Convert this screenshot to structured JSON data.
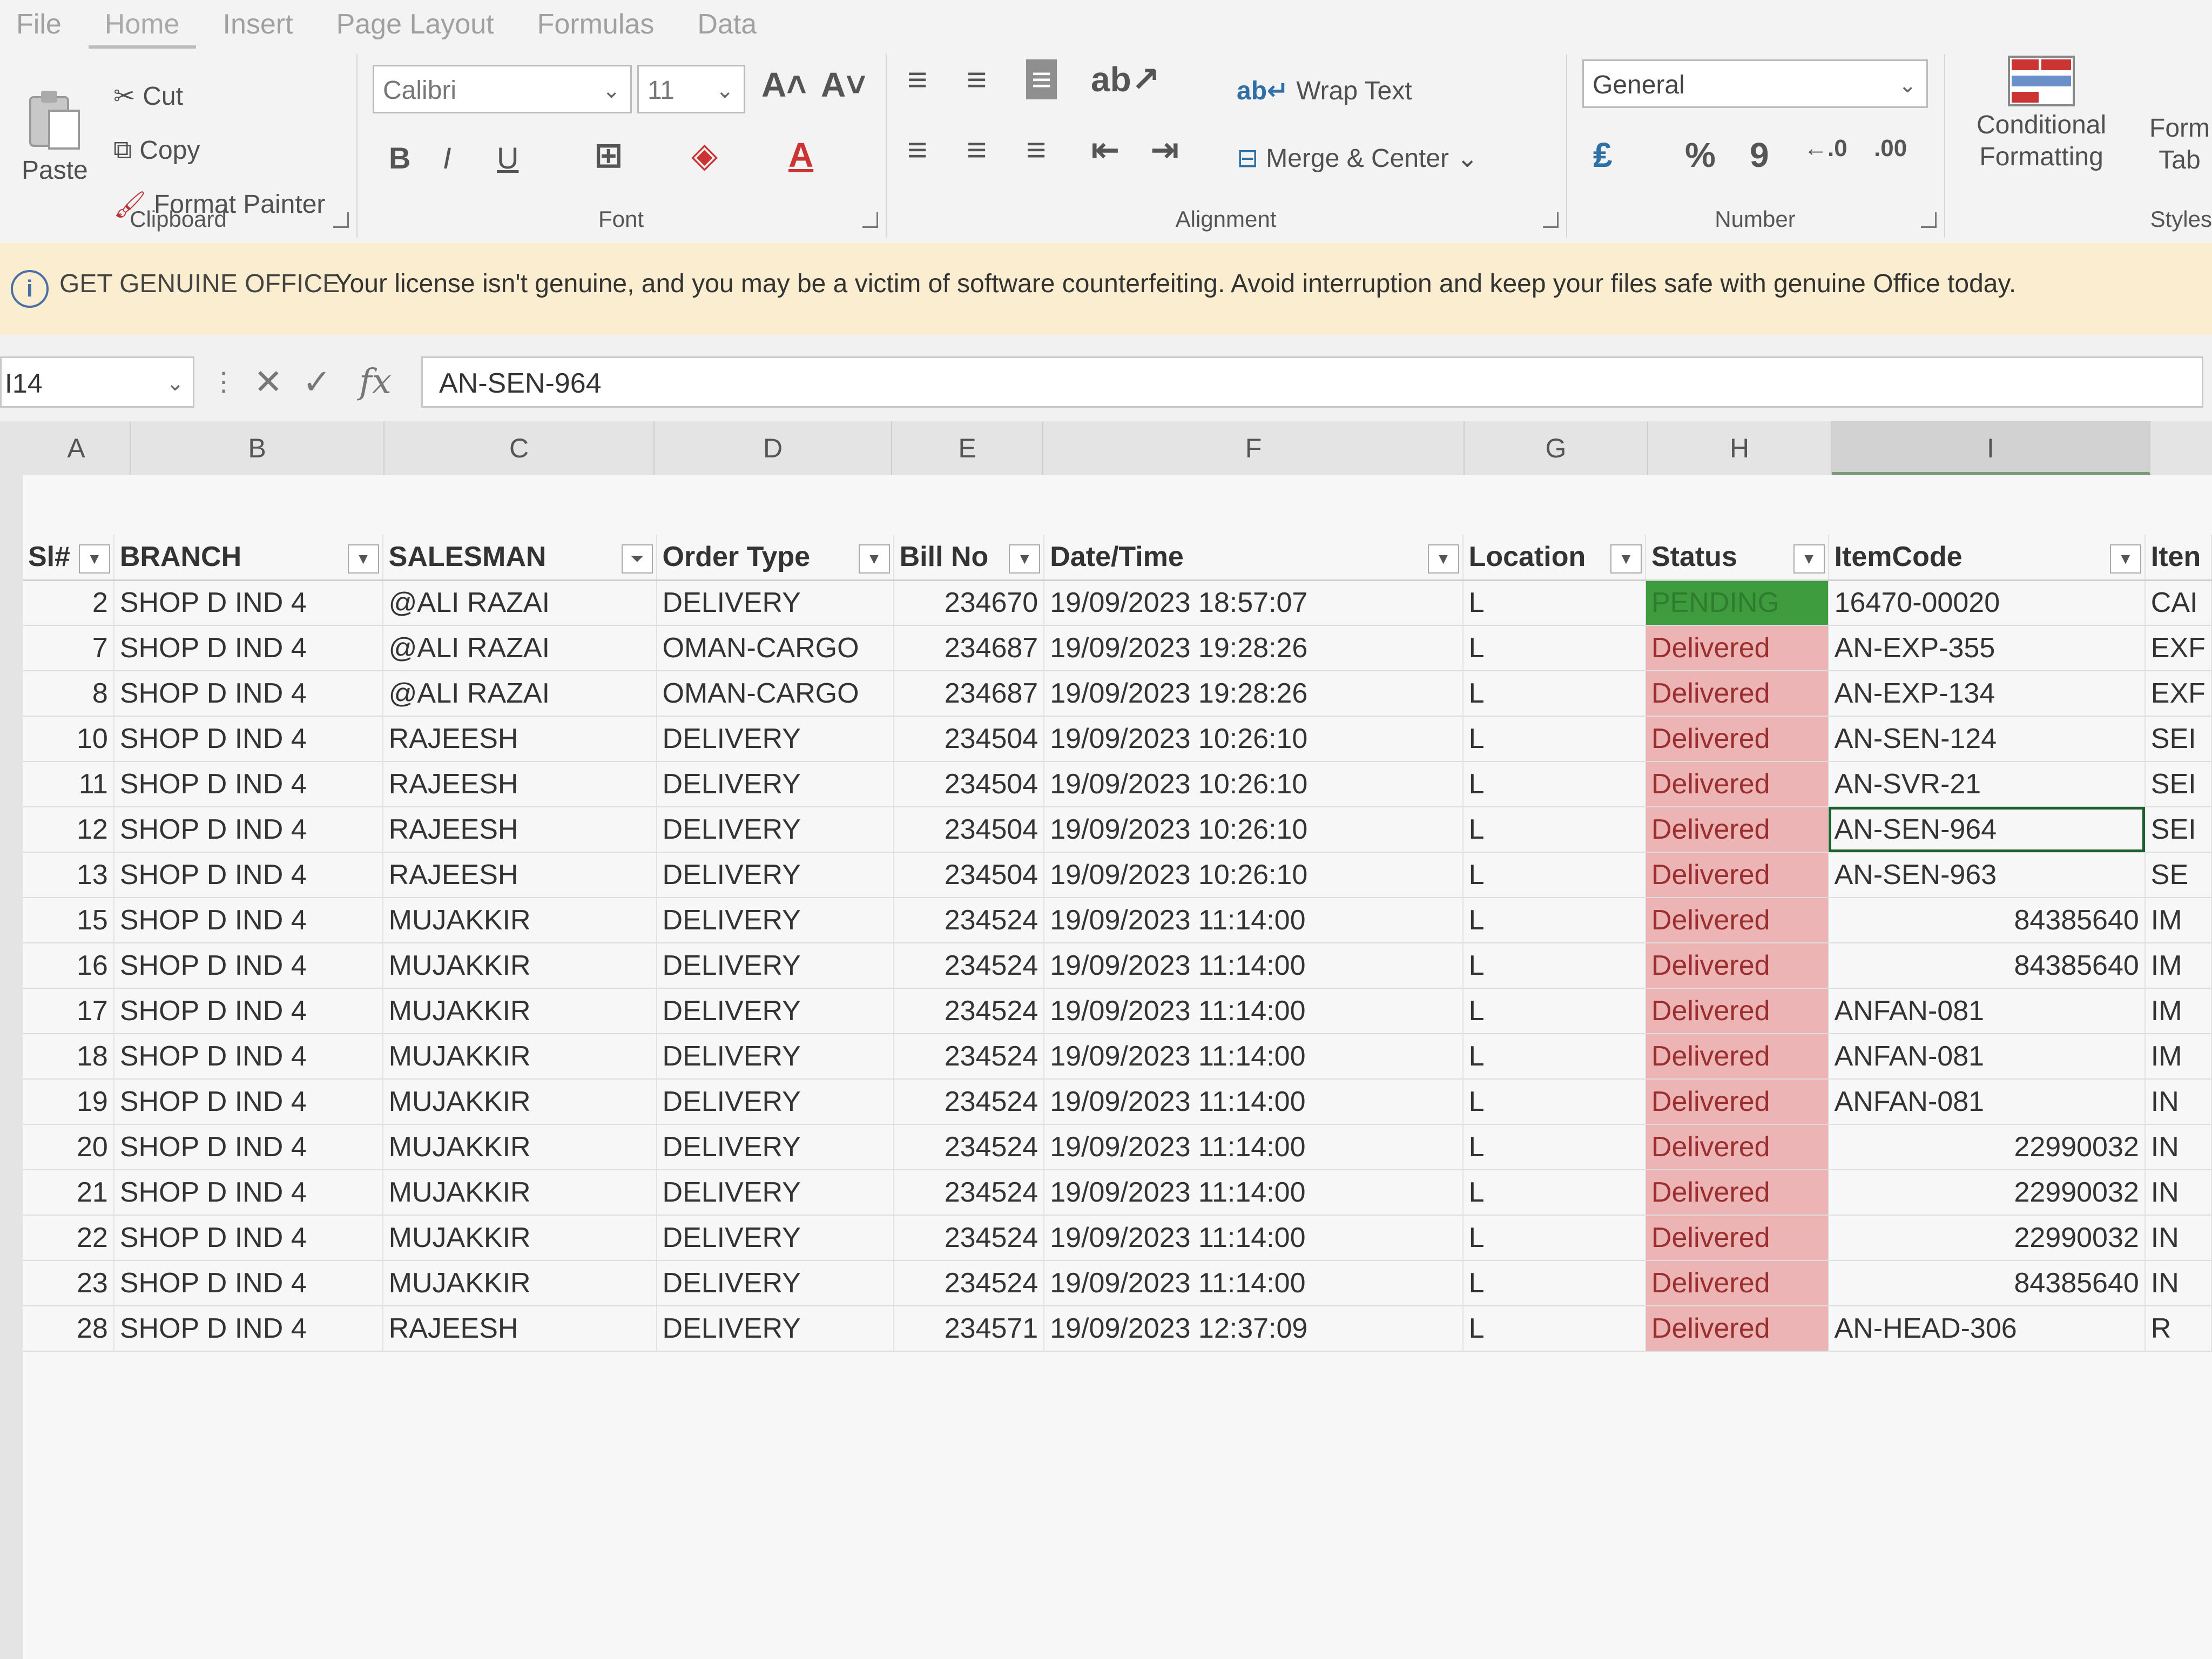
{
  "ribbon": {
    "tabs": [
      "File",
      "Home",
      "Insert",
      "Page Layout",
      "Formulas",
      "Data"
    ],
    "clipboard": {
      "paste": "Paste",
      "cut": "Cut",
      "copy": "Copy",
      "format_painter": "Format Painter",
      "label": "Clipboard"
    },
    "font": {
      "name": "Calibri",
      "size": "11",
      "label": "Font"
    },
    "alignment": {
      "wrap_text": "Wrap Text",
      "merge_center": "Merge & Center",
      "label": "Alignment"
    },
    "number": {
      "format": "General",
      "label": "Number"
    },
    "styles": {
      "conditional": "Conditional",
      "formatting": "Formatting",
      "format_as": "Form",
      "table": "Tab",
      "label": "Styles"
    }
  },
  "message_bar": {
    "title": "GET GENUINE OFFICE",
    "text": "Your license isn't genuine, and you may be a victim of software counterfeiting. Avoid interruption and keep your files safe with genuine Office today."
  },
  "formula_bar": {
    "name_box": "I14",
    "formula": "AN-SEN-964"
  },
  "columns": [
    "A",
    "B",
    "C",
    "D",
    "E",
    "F",
    "G",
    "H",
    "I"
  ],
  "table": {
    "headers": [
      "Sl#",
      "BRANCH",
      "SALESMAN",
      "Order Type",
      "Bill No",
      "Date/Time",
      "Location",
      "Status",
      "ItemCode",
      "Iten"
    ],
    "rows": [
      [
        "2",
        "SHOP D IND 4",
        "@ALI RAZAI",
        "DELIVERY",
        "234670",
        "19/09/2023 18:57:07",
        "L",
        "PENDING",
        "16470-00020",
        "CAI"
      ],
      [
        "7",
        "SHOP D IND 4",
        "@ALI RAZAI",
        "OMAN-CARGO",
        "234687",
        "19/09/2023 19:28:26",
        "L",
        "Delivered",
        "AN-EXP-355",
        "EXF"
      ],
      [
        "8",
        "SHOP D IND 4",
        "@ALI RAZAI",
        "OMAN-CARGO",
        "234687",
        "19/09/2023 19:28:26",
        "L",
        "Delivered",
        "AN-EXP-134",
        "EXF"
      ],
      [
        "10",
        "SHOP D IND 4",
        "RAJEESH",
        "DELIVERY",
        "234504",
        "19/09/2023 10:26:10",
        "L",
        "Delivered",
        "AN-SEN-124",
        "SEI"
      ],
      [
        "11",
        "SHOP D IND 4",
        "RAJEESH",
        "DELIVERY",
        "234504",
        "19/09/2023 10:26:10",
        "L",
        "Delivered",
        "AN-SVR-21",
        "SEI"
      ],
      [
        "12",
        "SHOP D IND 4",
        "RAJEESH",
        "DELIVERY",
        "234504",
        "19/09/2023 10:26:10",
        "L",
        "Delivered",
        "AN-SEN-964",
        "SEI"
      ],
      [
        "13",
        "SHOP D IND 4",
        "RAJEESH",
        "DELIVERY",
        "234504",
        "19/09/2023 10:26:10",
        "L",
        "Delivered",
        "AN-SEN-963",
        "SE"
      ],
      [
        "15",
        "SHOP D IND 4",
        "MUJAKKIR",
        "DELIVERY",
        "234524",
        "19/09/2023 11:14:00",
        "L",
        "Delivered",
        "84385640",
        "IM"
      ],
      [
        "16",
        "SHOP D IND 4",
        "MUJAKKIR",
        "DELIVERY",
        "234524",
        "19/09/2023 11:14:00",
        "L",
        "Delivered",
        "84385640",
        "IM"
      ],
      [
        "17",
        "SHOP D IND 4",
        "MUJAKKIR",
        "DELIVERY",
        "234524",
        "19/09/2023 11:14:00",
        "L",
        "Delivered",
        "ANFAN-081",
        "IM"
      ],
      [
        "18",
        "SHOP D IND 4",
        "MUJAKKIR",
        "DELIVERY",
        "234524",
        "19/09/2023 11:14:00",
        "L",
        "Delivered",
        "ANFAN-081",
        "IM"
      ],
      [
        "19",
        "SHOP D IND 4",
        "MUJAKKIR",
        "DELIVERY",
        "234524",
        "19/09/2023 11:14:00",
        "L",
        "Delivered",
        "ANFAN-081",
        "IN"
      ],
      [
        "20",
        "SHOP D IND 4",
        "MUJAKKIR",
        "DELIVERY",
        "234524",
        "19/09/2023 11:14:00",
        "L",
        "Delivered",
        "22990032",
        "IN"
      ],
      [
        "21",
        "SHOP D IND 4",
        "MUJAKKIR",
        "DELIVERY",
        "234524",
        "19/09/2023 11:14:00",
        "L",
        "Delivered",
        "22990032",
        "IN"
      ],
      [
        "22",
        "SHOP D IND 4",
        "MUJAKKIR",
        "DELIVERY",
        "234524",
        "19/09/2023 11:14:00",
        "L",
        "Delivered",
        "22990032",
        "IN"
      ],
      [
        "23",
        "SHOP D IND 4",
        "MUJAKKIR",
        "DELIVERY",
        "234524",
        "19/09/2023 11:14:00",
        "L",
        "Delivered",
        "84385640",
        "IN"
      ],
      [
        "28",
        "SHOP D IND 4",
        "RAJEESH",
        "DELIVERY",
        "234571",
        "19/09/2023 12:37:09",
        "L",
        "Delivered",
        "AN-HEAD-306",
        "R"
      ]
    ]
  },
  "row_numbers": [
    "",
    "",
    "",
    "",
    "",
    "",
    "",
    "",
    "",
    "",
    "",
    "",
    "",
    "",
    "",
    "",
    "",
    "",
    "",
    "",
    "",
    "",
    ""
  ],
  "colors": {
    "pending_fill": "#3e9b3e",
    "delivered_fill": "#ecb4b4",
    "delivered_text": "#9b2f2f",
    "message_bar": "#fbeed0"
  }
}
